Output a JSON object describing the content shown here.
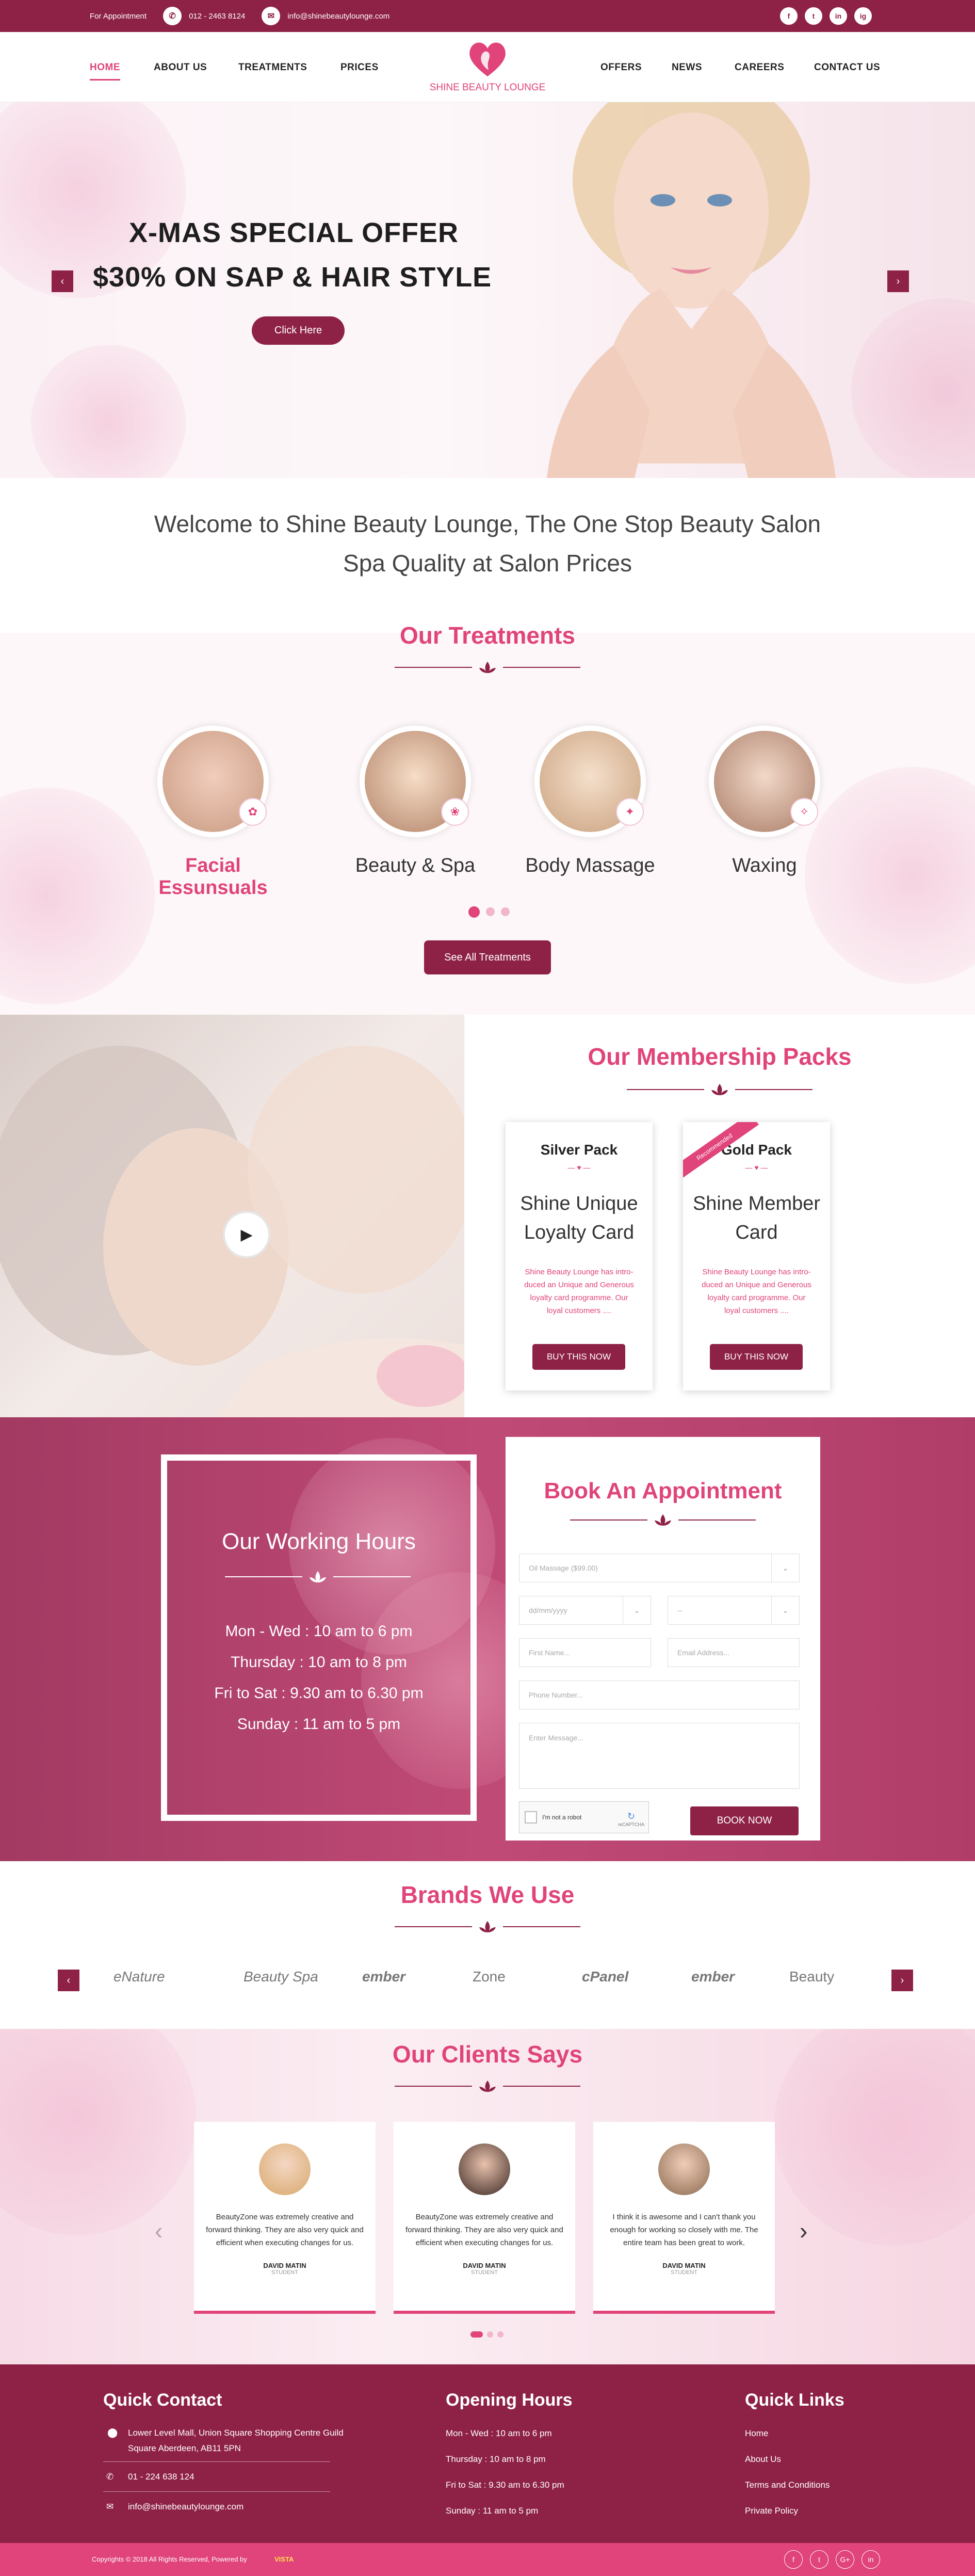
{
  "topbar": {
    "appointment_label": "For Appointment",
    "phone": "012 - 2463 8124",
    "email": "info@shinebeautylounge.com",
    "social": [
      "f",
      "t",
      "in",
      "ig"
    ]
  },
  "nav": {
    "left": [
      "HOME",
      "ABOUT US",
      "TREATMENTS",
      "PRICES"
    ],
    "right": [
      "OFFERS",
      "NEWS",
      "CAREERS",
      "CONTACT US"
    ],
    "logo_text": "SHINE BEAUTY LOUNGE"
  },
  "hero": {
    "line1": "X-MAS SPECIAL OFFER",
    "line2": "$30% ON SAP & HAIR STYLE",
    "cta": "Click Here",
    "prev": "‹",
    "next": "›"
  },
  "welcome": {
    "line1": "Welcome to Shine Beauty Lounge, The One Stop Beauty Salon",
    "line2": "Spa Quality at Salon Prices"
  },
  "treatments": {
    "title": "Our Treatments",
    "items": [
      "Facial Essunsuals",
      "Beauty & Spa",
      "Body Massage",
      "Waxing"
    ],
    "button": "See All Treatments"
  },
  "membership": {
    "title": "Our Membership Packs",
    "packs": [
      {
        "name": "Silver Pack",
        "sub": "Shine Unique Loyalty Card",
        "desc": "Shine Beauty Lounge has intro-duced an Unique and Generous loyalty card programme. Our loyal customers ....",
        "button": "BUY THIS NOW"
      },
      {
        "name": "Gold Pack",
        "sub": "Shine Member Card",
        "desc": "Shine Beauty Lounge has intro-duced an Unique and Generous loyalty card programme. Our loyal customers ....",
        "button": "BUY THIS NOW",
        "ribbon": "Recommended"
      }
    ]
  },
  "hours": {
    "title": "Our Working Hours",
    "rows": [
      "Mon - Wed : 10 am to 6 pm",
      "Thursday : 10 am  to 8 pm",
      "Fri to Sat : 9.30 am  to 6.30 pm",
      "Sunday : 11 am to 5 pm"
    ]
  },
  "appointment": {
    "title": "Book An Appointment",
    "service": "Oil Massage ($99.00)",
    "date": "dd/mm/yyyy",
    "time": "--",
    "first_name": "First Name...",
    "email": "Email Address...",
    "phone": "Phone Number...",
    "message": "Enter Message...",
    "captcha": "I'm not a robot",
    "captcha_brand": "reCAPTCHA",
    "button": "BOOK NOW"
  },
  "brands": {
    "title": "Brands We Use",
    "items": [
      "eNature",
      "Beauty Spa",
      "ember",
      "Zone",
      "cPanel",
      "ember",
      "Beauty"
    ]
  },
  "clients": {
    "title": "Our Clients Says",
    "cards": [
      {
        "quote": "BeautyZone was extremely creative and forward thinking. They are also very quick and efficient when executing changes for us.",
        "name": "DAVID MATIN",
        "role": "STUDENT"
      },
      {
        "quote": "BeautyZone was extremely creative and forward thinking. They are also very quick and efficient when executing changes for us.",
        "name": "DAVID MATIN",
        "role": "STUDENT"
      },
      {
        "quote": "I think it is awesome and I can't thank you enough for working so closely with me. The entire team has been great to work.",
        "name": "DAVID MATIN",
        "role": "STUDENT"
      }
    ],
    "prev": "‹",
    "next": "›"
  },
  "footer": {
    "contact_title": "Quick Contact",
    "address": "Lower Level Mall, Union Square Shopping Centre Guild Square Aberdeen, AB11 5PN",
    "phone": "01 - 224 638 124",
    "email": "info@shinebeautylounge.com",
    "hours_title": "Opening Hours",
    "hours": [
      "Mon - Wed : 10 am to 6 pm",
      "Thursday : 10 am  to 8 pm",
      "Fri to Sat : 9.30 am  to 6.30 pm",
      "Sunday : 11 am to 5 pm"
    ],
    "links_title": "Quick Links",
    "links": [
      "Home",
      "About Us",
      "Terms and Conditions",
      "Private Policy"
    ],
    "copyright": "Copyrights © 2018 All Rights Reserved, Powered by",
    "powered_by": "VISTA",
    "social": [
      "f",
      "t",
      "G+",
      "in"
    ]
  },
  "colors": {
    "maroon": "#8e2246",
    "pink": "#e0447a"
  }
}
